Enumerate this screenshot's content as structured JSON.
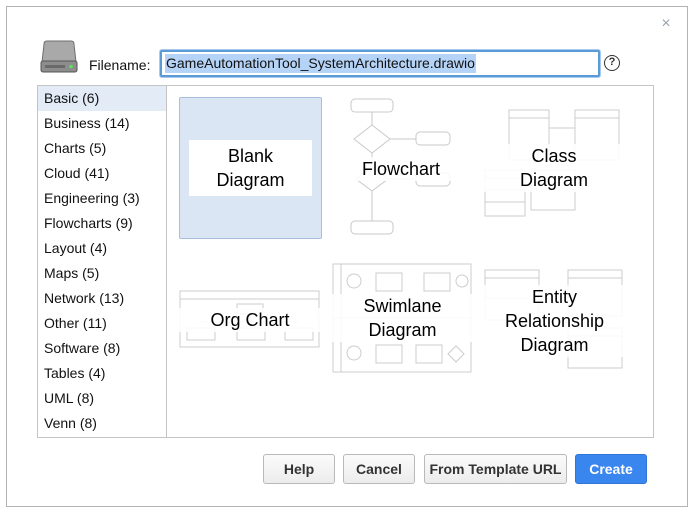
{
  "dialog": {
    "filename_label": "Filename:",
    "filename_value": "GameAutomationTool_SystemArchitecture.drawio",
    "help_icon": "?",
    "close_icon": "×"
  },
  "categories": [
    {
      "label": "Basic (6)",
      "active": true
    },
    {
      "label": "Business (14)"
    },
    {
      "label": "Charts (5)"
    },
    {
      "label": "Cloud (41)"
    },
    {
      "label": "Engineering (3)"
    },
    {
      "label": "Flowcharts (9)"
    },
    {
      "label": "Layout (4)"
    },
    {
      "label": "Maps (5)"
    },
    {
      "label": "Network (13)"
    },
    {
      "label": "Other (11)"
    },
    {
      "label": "Software (8)"
    },
    {
      "label": "Tables (4)"
    },
    {
      "label": "UML (8)"
    },
    {
      "label": "Venn (8)"
    }
  ],
  "templates": {
    "blank": "Blank\nDiagram",
    "flowchart": "Flowchart",
    "class": "Class\nDiagram",
    "org": "Org Chart",
    "swimlane": "Swimlane\nDiagram",
    "er": "Entity\nRelationship\nDiagram"
  },
  "buttons": {
    "help": "Help",
    "cancel": "Cancel",
    "from_url": "From Template URL",
    "create": "Create"
  },
  "colors": {
    "accent": "#3a86ef",
    "selection": "#b5d3f7",
    "active_category": "#e2ebf6"
  }
}
